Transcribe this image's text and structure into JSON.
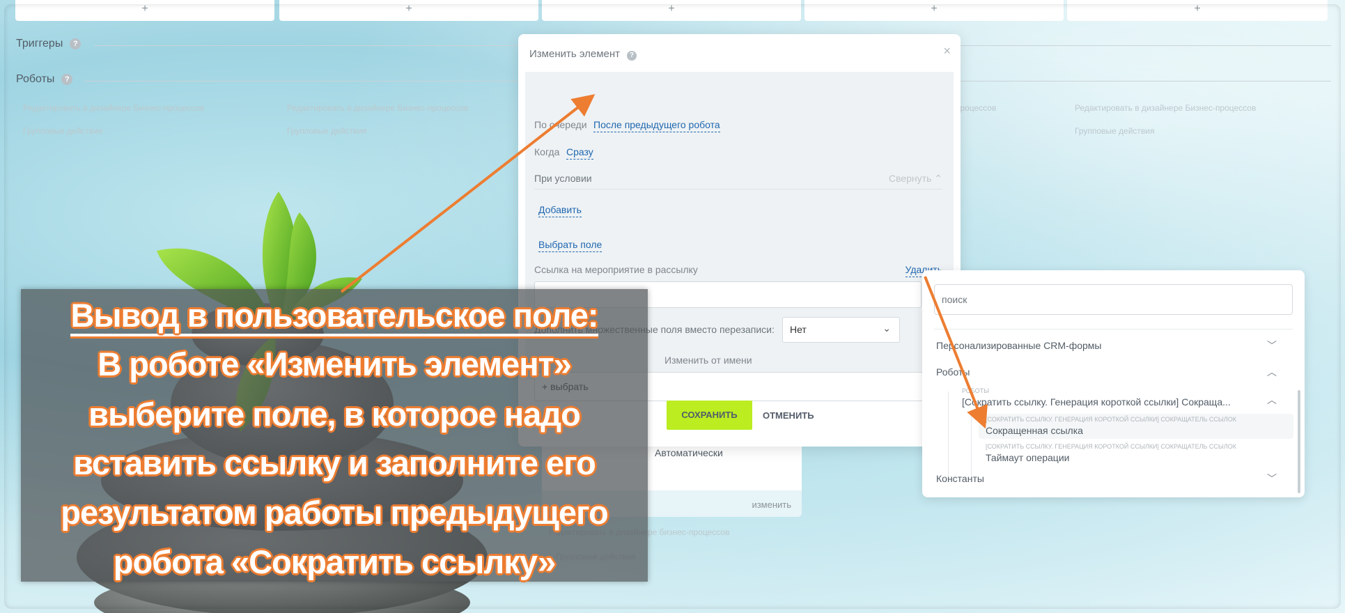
{
  "columns": {
    "add_label": "+"
  },
  "sections": {
    "triggers": "Триггеры",
    "robots": "Роботы",
    "help": "?"
  },
  "faint": {
    "edit_designer": "Редактировать в дизайнере Бизнес-процессов",
    "edit_designer_lower": "Редактировать в дизайнере бизнес-процессов",
    "group_actions": "Групповые действия",
    "automatic": "Автоматически",
    "change": "изменить"
  },
  "dialog": {
    "title": "Изменить элемент",
    "close": "×",
    "order_label": "По очереди",
    "order_value": "После предыдущего робота",
    "when_label": "Когда",
    "when_value": "Сразу",
    "condition_label": "При условии",
    "collapse": "Свернуть",
    "add": "Добавить",
    "choose_field": "Выбрать поле",
    "field_label": "Ссылка на мероприятие в рассылку",
    "delete": "Удалить",
    "field_value": "",
    "more": "•••",
    "append_label": "Дополнить множественные поля вместо перезаписи:",
    "append_value": "Нет",
    "as_user_label": "Изменить от имени",
    "choose": "+ выбрать",
    "save": "СОХРАНИТЬ",
    "cancel": "ОТМЕНИТЬ"
  },
  "panel": {
    "search_placeholder": "поиск",
    "groups": [
      "Персонализированные CRM-формы",
      "Роботы",
      "Константы"
    ],
    "robots_caption": "РОБОТЫ",
    "robot_item": "[Сократить ссылку. Генерация короткой ссылки] Сокраща...",
    "fields": [
      {
        "caption": "[Сократить ссылку. Генерация короткой ссылки] Сокращатель ссылок",
        "label": "Сокращенная ссылка"
      },
      {
        "caption": "[Сократить ссылку. Генерация короткой ссылки] Сокращатель ссылок",
        "label": "Таймаут операции"
      }
    ]
  },
  "annotation": {
    "title": "Вывод в пользовательское поле:",
    "lines": [
      "В роботе «Изменить элемент»",
      "выберите поле, в которое надо",
      "вставить ссылку и заполните его",
      "результатом работы предыдущего",
      "робота «Сократить ссылку»"
    ]
  },
  "colors": {
    "accent": "#2067b0",
    "save": "#bbed21",
    "arrow": "#ed7d31"
  }
}
